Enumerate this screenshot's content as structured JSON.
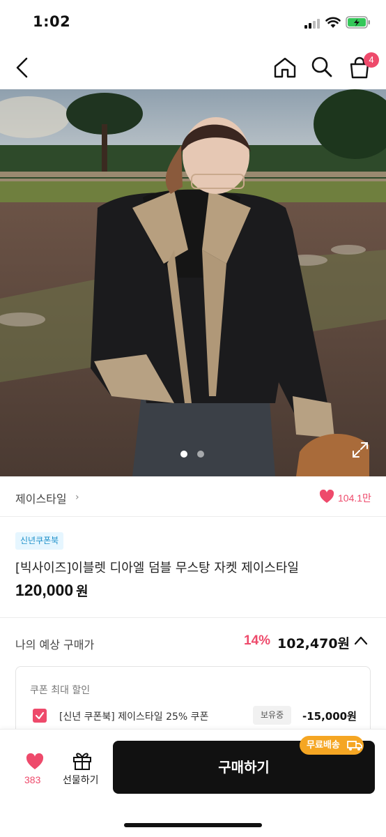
{
  "status": {
    "time": "1:02"
  },
  "nav": {
    "cart_count": "4"
  },
  "brand": {
    "name": "제이스타일",
    "chevron": "›",
    "likes": "104.1만"
  },
  "product": {
    "badge": "신년쿠폰북",
    "title": "[빅사이즈]이블렛 디아엘 덤블 무스탕 자켓 제이스타일",
    "price": "120,000",
    "price_unit": "원",
    "image_page": 1,
    "image_count": 2
  },
  "expected": {
    "label": "나의 예상 구매가",
    "rate": "14%",
    "price": "102,470원"
  },
  "coupon": {
    "heading": "쿠폰 최대 할인",
    "name": "[신년 쿠폰북] 제이스타일 25% 쿠폰",
    "tag": "보유중",
    "amount": "-15,000원",
    "checked": true
  },
  "bottom": {
    "like_count": "383",
    "gift_label": "선물하기",
    "buy_label": "구매하기",
    "free_shipping": "무료배송"
  },
  "colors": {
    "accent": "#ee4a6b",
    "badge_bg": "#e6f6ff",
    "badge_text": "#1b8fc9",
    "buy_bg": "#111111",
    "free_ship_bg": "#f5a623"
  }
}
